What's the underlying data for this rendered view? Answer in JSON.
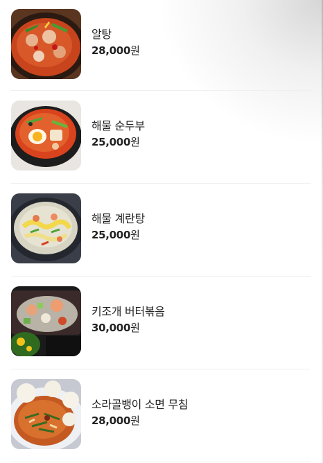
{
  "menu": {
    "items": [
      {
        "name": "알탕",
        "amount": "28,000",
        "currency": "원",
        "image_icon": "altang-photo"
      },
      {
        "name": "해물 순두부",
        "amount": "25,000",
        "currency": "원",
        "image_icon": "seafood-sundubu-photo"
      },
      {
        "name": "해물 계란탕",
        "amount": "25,000",
        "currency": "원",
        "image_icon": "seafood-egg-soup-photo"
      },
      {
        "name": "키조개 버터볶음",
        "amount": "30,000",
        "currency": "원",
        "image_icon": "pen-shell-butter-photo"
      },
      {
        "name": "소라골뱅이 소면 무침",
        "amount": "28,000",
        "currency": "원",
        "image_icon": "whelk-somen-photo"
      }
    ]
  }
}
